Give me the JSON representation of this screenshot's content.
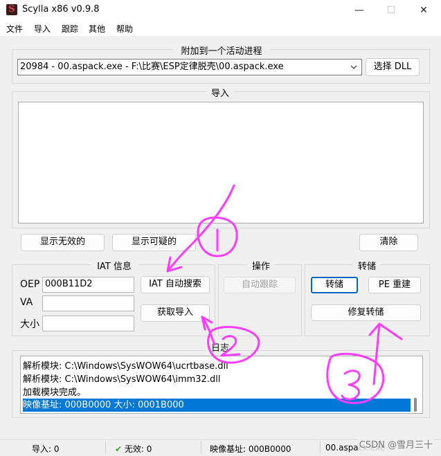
{
  "window": {
    "title": "Scylla x86 v0.9.8",
    "minimize": "—",
    "maximize": "☐",
    "close": "✕"
  },
  "menu": [
    "文件",
    "导入",
    "跟踪",
    "其他",
    "帮助"
  ],
  "attach": {
    "label": "附加到一个活动进程",
    "process": "20984 - 00.aspack.exe - F:\\比赛\\ESP定律脱壳\\00.aspack.exe",
    "dropdown_arrow": "chevron-down-icon",
    "select_dll": "选择 DLL"
  },
  "imports": {
    "label": "导入"
  },
  "import_buttons": {
    "show_invalid": "显示无效的",
    "show_suspect": "显示可疑的",
    "clear": "清除"
  },
  "iat": {
    "label": "IAT 信息",
    "oep_label": "OEP",
    "oep_value": "000B11D2",
    "va_label": "VA",
    "va_value": "",
    "size_label": "大小",
    "size_value": "",
    "autosearch": "IAT 自动搜索",
    "get_imports": "获取导入"
  },
  "actions": {
    "label": "操作",
    "autotrace": "自动跟踪"
  },
  "dump": {
    "label": "转储",
    "dump": "转储",
    "pe_rebuild": "PE 重建",
    "fix_dump": "修复转储"
  },
  "log": {
    "label": "日志",
    "lines": [
      "解析模块: C:\\Windows\\SysWOW64\\ucrtbase.dll",
      "解析模块: C:\\Windows\\SysWOW64\\imm32.dll",
      "加载模块完成。",
      "映像基址: 000B0000 大小: 0001B000"
    ],
    "selected_index": 3
  },
  "status": {
    "imports": "导入: 0",
    "invalid": "无效: 0",
    "check_icon": "checkmark-icon",
    "image_base": "映像基址: 000B0000",
    "module": "00.aspack.exe"
  },
  "watermark": "CSDN @雪月三十",
  "annotations": {
    "color": "#ff3cff",
    "step1": "①",
    "step2": "②",
    "step3": "③"
  }
}
